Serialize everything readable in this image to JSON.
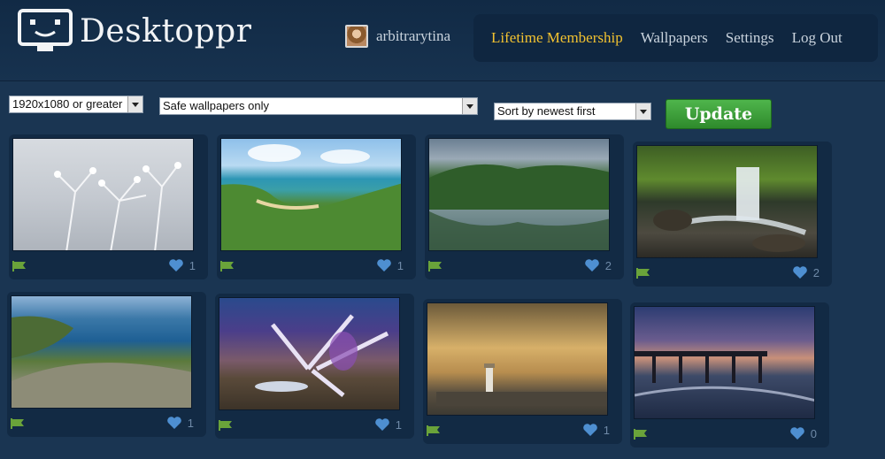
{
  "app": {
    "name": "Desktoppr"
  },
  "user": {
    "name": "arbitrarytina"
  },
  "nav": [
    {
      "label": "Lifetime Membership"
    },
    {
      "label": "Wallpapers"
    },
    {
      "label": "Settings"
    },
    {
      "label": "Log Out"
    }
  ],
  "filters": {
    "resolution": "1920x1080 or greater",
    "safety": "Safe wallpapers only",
    "sort": "Sort by newest first",
    "update_label": "Update"
  },
  "colors": {
    "background": "#1a3552",
    "accent": "#f2c230",
    "button": "#3f9f3c",
    "flag": "#6aa33a",
    "heart": "#4e8fd1"
  },
  "wallpapers": [
    {
      "likes": "1"
    },
    {
      "likes": "1"
    },
    {
      "likes": "2"
    },
    {
      "likes": "2"
    },
    {
      "likes": "1"
    },
    {
      "likes": "1"
    },
    {
      "likes": "1"
    },
    {
      "likes": "0"
    }
  ]
}
